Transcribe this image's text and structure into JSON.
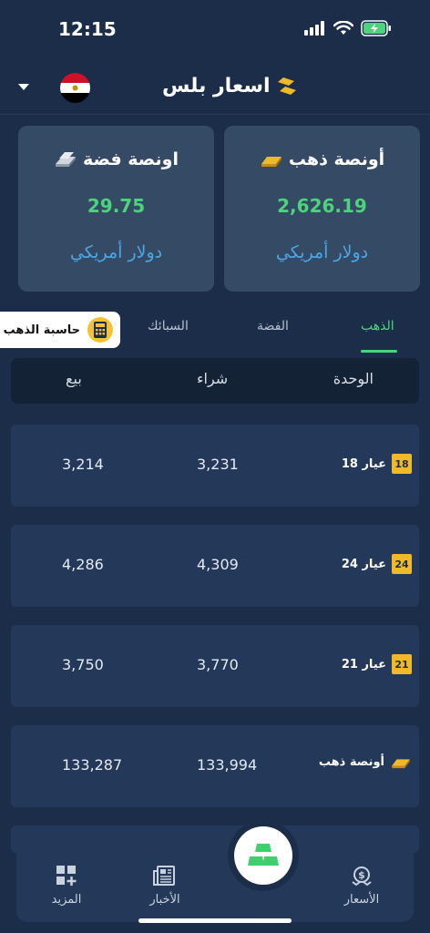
{
  "status": {
    "time": "12:15"
  },
  "header": {
    "app_name": "اسعار بلس"
  },
  "cards": {
    "gold": {
      "title": "أونصة ذهب",
      "price": "2,626.19",
      "unit": "دولار أمريكي"
    },
    "silver": {
      "title": "اونصة فضة",
      "price": "29.75",
      "unit": "دولار أمريكي"
    }
  },
  "tabs": [
    {
      "label": "الذهب",
      "active": true
    },
    {
      "label": "الفضة",
      "active": false
    },
    {
      "label": "السبائك",
      "active": false
    }
  ],
  "calculator": {
    "label": "حاسبة الذهب"
  },
  "table": {
    "headers": {
      "unit": "الوحدة",
      "buy": "شراء",
      "sell": "بيع"
    },
    "rows": [
      {
        "badge": "18",
        "unit": "عيار 18",
        "buy": "3,231",
        "sell": "3,214"
      },
      {
        "badge": "24",
        "unit": "عيار 24",
        "buy": "4,309",
        "sell": "4,286"
      },
      {
        "badge": "21",
        "unit": "عيار 21",
        "buy": "3,770",
        "sell": "3,750"
      },
      {
        "badge": "",
        "unit": "أونصة ذهب",
        "buy": "133,994",
        "sell": "133,287"
      }
    ]
  },
  "nav": {
    "prices": "الأسعار",
    "news": "الأخبار",
    "more": "المزيد"
  },
  "colors": {
    "background": "#1b2d48",
    "card": "#354a64",
    "accent_green": "#4bd47b",
    "accent_blue": "#49a7e6",
    "gold": "#f0b92a"
  }
}
